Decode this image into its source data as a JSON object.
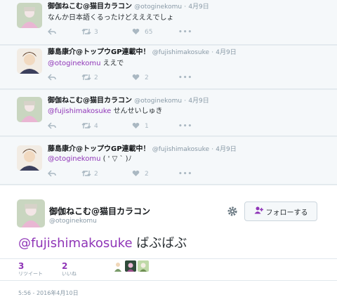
{
  "tweets": [
    {
      "name": "御伽ねこむ@猫目カラコン",
      "handle": "@otoginekomu",
      "time": "4月9日",
      "mention": "",
      "text": "なんか日本語くるったけどえええでしょ",
      "retweets": "3",
      "likes": "65"
    },
    {
      "name": "藤島康介@トップウGP連載中！",
      "handle": "@fujishimakosuke",
      "time": "4月9日",
      "mention": "@otoginekomu",
      "text": "ええで",
      "retweets": "2",
      "likes": "2"
    },
    {
      "name": "御伽ねこむ@猫目カラコン",
      "handle": "@otoginekomu",
      "time": "4月9日",
      "mention": "@fujishimakosuke",
      "text": "せんせいしゅき",
      "retweets": "4",
      "likes": "1"
    },
    {
      "name": "藤島康介@トップウGP連載中！",
      "handle": "@fujishimakosuke",
      "time": "4月9日",
      "mention": "@otoginekomu",
      "text": "( ' ▽ ` )ﾉ",
      "retweets": "2",
      "likes": "2"
    }
  ],
  "main_tweet": {
    "name": "御伽ねこむ@猫目カラコン",
    "handle": "@otoginekomu",
    "follow_label": "フォローする",
    "mention": "@fujishimakosuke",
    "text": "ばぶばぶ",
    "retweet_count": "3",
    "retweet_label": "リツイート",
    "like_count": "2",
    "like_label": "いいね",
    "timestamp": "5:56 - 2016年4月10日"
  },
  "colors": {
    "accent": "#8f35b7",
    "meta": "#8899a6",
    "background": "#f5f8fa"
  },
  "icons": [
    "reply-icon",
    "retweet-icon",
    "heart-icon",
    "more-icon",
    "gear-icon",
    "follow-person-icon"
  ]
}
